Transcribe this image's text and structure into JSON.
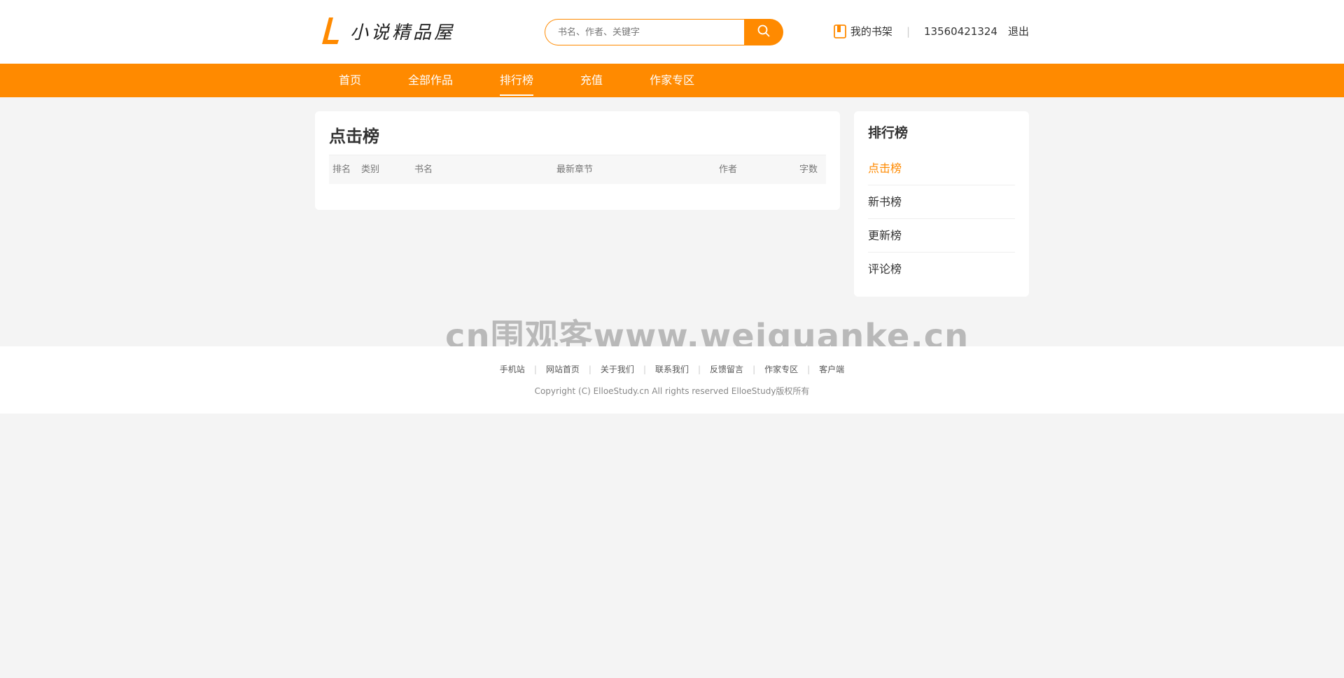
{
  "brand": {
    "name": "小说精品屋",
    "accent": "#ff8a00"
  },
  "search": {
    "placeholder": "书名、作者、关键字"
  },
  "user": {
    "shelf_label": "我的书架",
    "separator": "|",
    "account": "13560421324",
    "logout_label": "退出"
  },
  "nav": {
    "items": [
      {
        "label": "首页"
      },
      {
        "label": "全部作品"
      },
      {
        "label": "排行榜"
      },
      {
        "label": "充值"
      },
      {
        "label": "作家专区"
      }
    ],
    "active": "排行榜"
  },
  "main": {
    "title": "点击榜",
    "columns": [
      "排名",
      "类别",
      "书名",
      "最新章节",
      "作者",
      "字数"
    ],
    "rows": []
  },
  "sidebar": {
    "title": "排行榜",
    "items": [
      {
        "label": "点击榜"
      },
      {
        "label": "新书榜"
      },
      {
        "label": "更新榜"
      },
      {
        "label": "评论榜"
      }
    ],
    "active": "点击榜"
  },
  "watermark": "cn围观客www.weiguanke.cn",
  "footer": {
    "links": [
      "手机站",
      "网站首页",
      "关于我们",
      "联系我们",
      "反馈留言",
      "作家专区",
      "客户端"
    ],
    "separator": "|",
    "copyright": "Copyright (C) ElloeStudy.cn All rights reserved  ElloeStudy版权所有"
  },
  "icons": {
    "logo": "logo-l-icon",
    "search": "search-icon",
    "shelf": "bookshelf-icon"
  }
}
